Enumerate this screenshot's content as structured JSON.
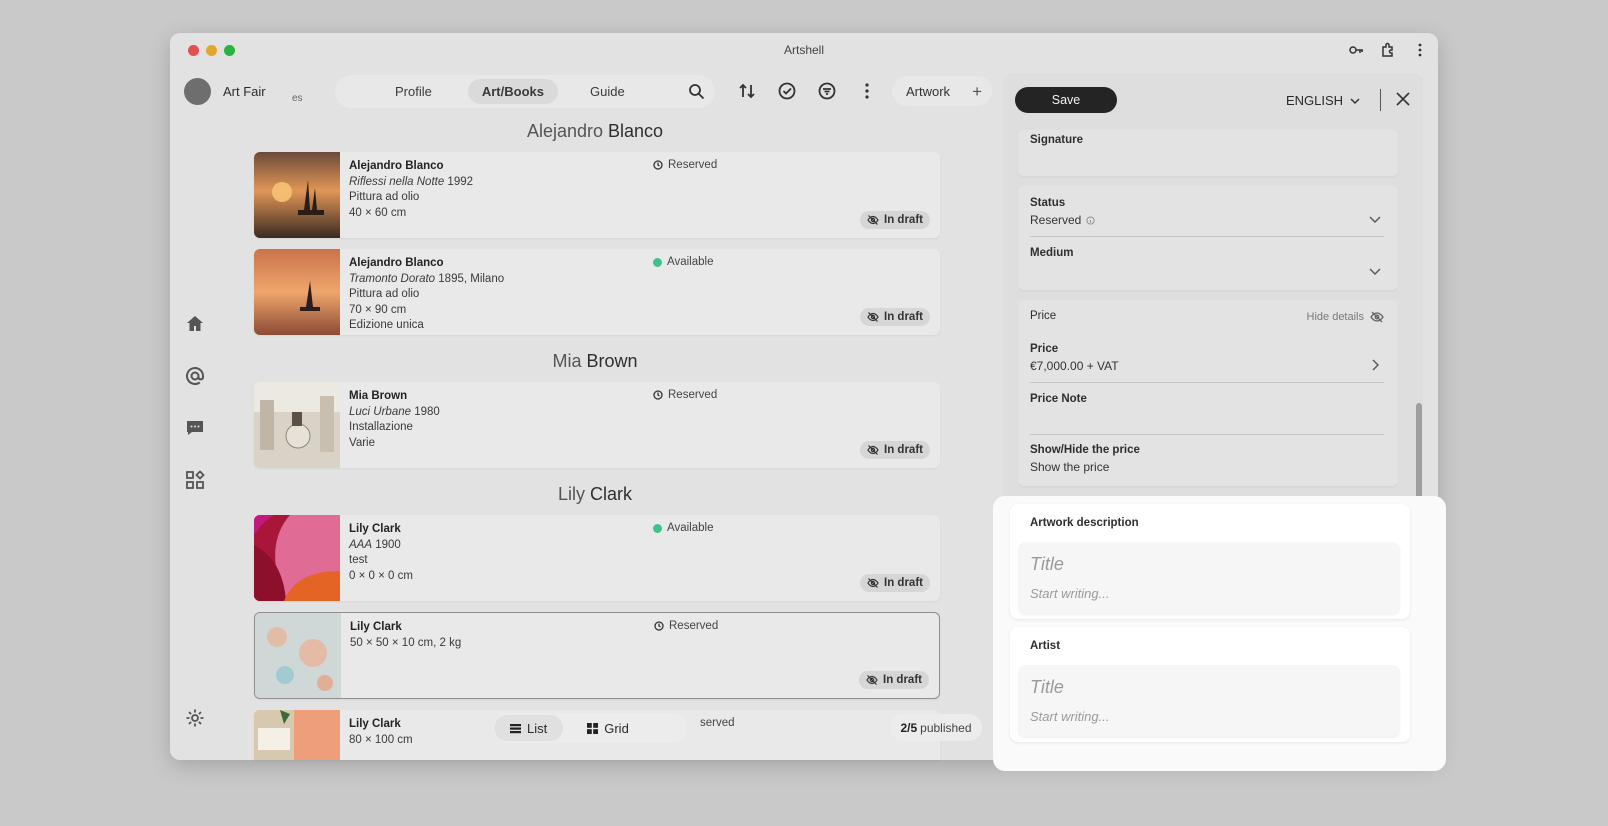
{
  "app": {
    "title": "Artshell"
  },
  "user": {
    "name": "Art Fair",
    "subtitle": "es"
  },
  "nav": {
    "tabs": [
      {
        "label": "Profile"
      },
      {
        "label": "Art/Books"
      },
      {
        "label": "Guide"
      }
    ],
    "active": "Art/Books"
  },
  "toolbar": {
    "artwork_label": "Artwork"
  },
  "groups": [
    {
      "first": "Alejandro",
      "last": "Blanco",
      "cards": [
        {
          "artist": "Alejandro Blanco",
          "title": "Riflessi nella Notte",
          "title_rest": " 1992",
          "lines": [
            "Pittura ad olio",
            "40 × 60 cm"
          ],
          "status": "Reserved",
          "badge": "In draft"
        },
        {
          "artist": "Alejandro Blanco",
          "title": "Tramonto Dorato",
          "title_rest": " 1895, Milano",
          "lines": [
            "Pittura ad olio",
            "70 × 90 cm",
            "Edizione unica"
          ],
          "status": "Available",
          "badge": "In draft"
        }
      ]
    },
    {
      "first": "Mia",
      "last": "Brown",
      "cards": [
        {
          "artist": "Mia Brown",
          "title": "Luci Urbane",
          "title_rest": " 1980",
          "lines": [
            "Installazione",
            "Varie"
          ],
          "status": "Reserved",
          "badge": "In draft"
        }
      ]
    },
    {
      "first": "Lily",
      "last": "Clark",
      "cards": [
        {
          "artist": "Lily Clark",
          "title": "AAA",
          "title_rest": " 1900",
          "lines": [
            "test",
            "0 × 0 × 0 cm"
          ],
          "status": "Available",
          "badge": "In draft"
        },
        {
          "artist": "Lily Clark",
          "lines": [
            "50 × 50 × 10 cm, 2 kg"
          ],
          "status": "Reserved",
          "badge": "In draft"
        },
        {
          "artist": "Lily Clark",
          "lines": [
            "80 × 100 cm"
          ],
          "status": "served"
        }
      ]
    }
  ],
  "view_toggle": {
    "list": "List",
    "grid": "Grid"
  },
  "published": {
    "count": "2/5",
    "label": "published"
  },
  "panel": {
    "save": "Save",
    "language": "ENGLISH",
    "signature_label": "Signature",
    "status_label": "Status",
    "status_value": "Reserved",
    "medium_label": "Medium",
    "price_section": "Price",
    "hide_details": "Hide details",
    "price_label": "Price",
    "price_value": "€7,000.00 + VAT",
    "price_note_label": "Price Note",
    "show_hide_label": "Show/Hide the price",
    "show_hide_value": "Show the price",
    "description_label": "Artwork description",
    "artist_label": "Artist",
    "editor_title_placeholder": "Title",
    "editor_body_placeholder": "Start writing..."
  },
  "colors": {
    "available": "#3ec28b",
    "save_bg": "#242424"
  }
}
